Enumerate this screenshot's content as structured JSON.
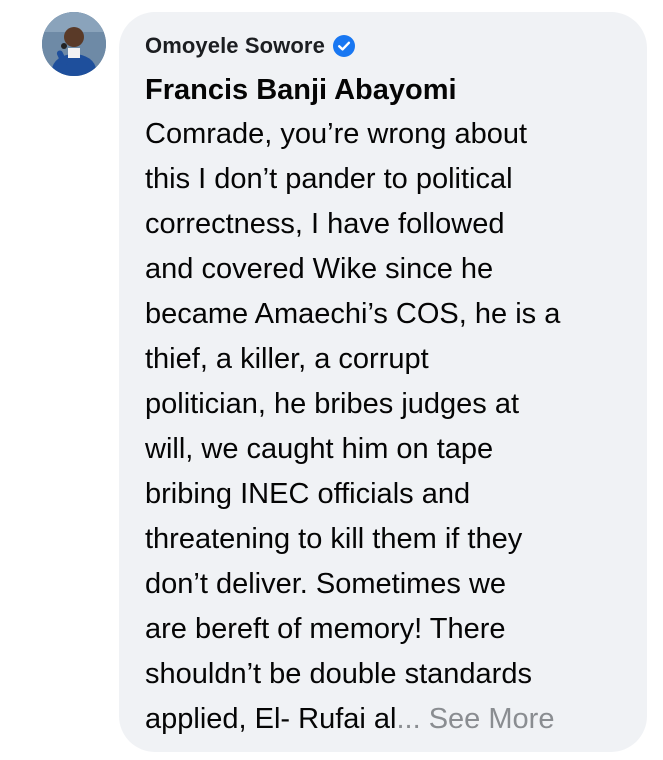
{
  "comment": {
    "author_name": "Omoyele Sowore",
    "verified_icon": "verified-badge-icon",
    "mention": "Francis Banji Abayomi",
    "body_lines": [
      "Comrade, you’re wrong about",
      "this I don’t pander to political",
      "correctness, I have followed",
      "and covered Wike since he",
      "became Amaechi’s COS, he is a",
      "thief, a killer, a corrupt",
      "politician, he bribes judges at",
      "will, we caught him on tape",
      "bribing INEC officials and",
      "threatening to kill them if they",
      "don’t deliver. Sometimes we",
      "are bereft of memory! There",
      "shouldn’t be double standards"
    ],
    "last_line_text": "applied, El- Rufai al",
    "see_more_label": "... See More"
  },
  "colors": {
    "bubble_bg": "#f0f2f5",
    "text": "#050505",
    "verified_blue": "#1877f2",
    "see_more_gray": "#8a8d91"
  }
}
